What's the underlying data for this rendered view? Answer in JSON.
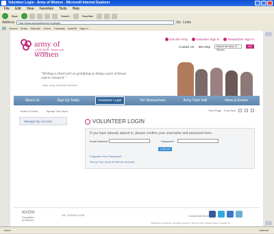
{
  "window": {
    "title": "Volunteer Login - Army of Women - Microsoft Internet Explorer"
  },
  "menubar": [
    "File",
    "Edit",
    "View",
    "Favorites",
    "Tools",
    "Help"
  ],
  "toolbar": {
    "back": "Back",
    "search": "Search",
    "favorites": "Favorites"
  },
  "address": {
    "label": "Address",
    "url": "http://www.armyofwomen.org/login",
    "go": "Go",
    "links": "Links"
  },
  "linkbar": {
    "search": "Search",
    "share": "Share",
    "sidewiki": "Sidewiki",
    "check": "Check",
    "translate": "Translate",
    "autofill": "AutoFill",
    "signin": "Sign In"
  },
  "site": {
    "brand": "army of women",
    "tagline": "LOVE AVON · Susan Love Foundation",
    "toplinks": [
      "Join the Army",
      "Volunteer Sign In",
      "Researcher Sign In"
    ],
    "subnav": {
      "contact": "Contact Us",
      "sitemap": "Site Map",
      "search_placeholder": "Search the Army of Women",
      "go": "GO"
    },
    "quote": "\"Writing a check isn't as gratifying as being a part of breast cancer research.\"",
    "quote_source": "Dana, Army of Women Volunteer",
    "nav": [
      "About Us",
      "Sign Up Today",
      "Volunteer Login",
      "For Researchers",
      "Army Town Hall",
      "News & Events"
    ],
    "util": {
      "invite": "Invite a Friend",
      "spread": "Spread The Word",
      "print": "Print Page",
      "fontsize": "Font Size"
    },
    "left_menu": "Manage My Account",
    "login": {
      "title": "VOLUNTEER LOGIN",
      "instructions": "If you have already signed in, please confirm your username and password here.",
      "email_label": "Email Address*",
      "password_label": "Password*",
      "button": "LOG IN",
      "forgot": "Forgotten Your Password?",
      "setup": "Set up Your Army of Women Account"
    },
    "footer": {
      "avon": "AVON",
      "avon_sub1": "Foundation",
      "avon_sub2": "for Women",
      "dsl": "DR. SUSAN LOVE",
      "connect": "Connect with the Army",
      "copyright": "©2010 Army of Women. All rights reserved. | Terms of Use | Privacy Policy | Contact Us"
    }
  },
  "status": {
    "left": "Done",
    "right": "Internet"
  }
}
